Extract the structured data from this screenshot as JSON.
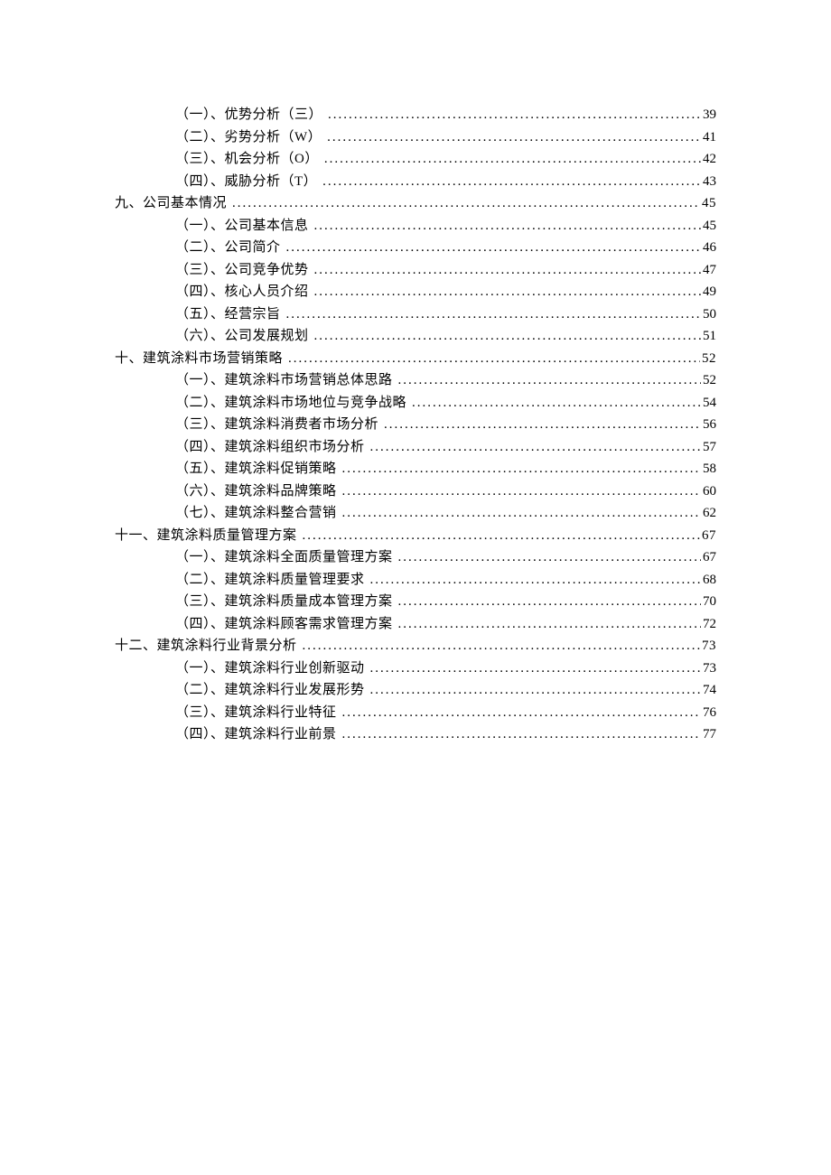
{
  "toc": [
    {
      "level": 2,
      "label": "（一）、优势分析（三）",
      "page": "39"
    },
    {
      "level": 2,
      "label": "（二）、劣势分析（W）",
      "page": "41"
    },
    {
      "level": 2,
      "label": "（三）、机会分析（O）",
      "page": "42"
    },
    {
      "level": 2,
      "label": "（四）、威胁分析（T）",
      "page": "43"
    },
    {
      "level": 1,
      "label": "九、公司基本情况",
      "page": "45"
    },
    {
      "level": 2,
      "label": "（一）、公司基本信息",
      "page": "45"
    },
    {
      "level": 2,
      "label": "（二）、公司简介",
      "page": "46"
    },
    {
      "level": 2,
      "label": "（三）、公司竞争优势",
      "page": "47"
    },
    {
      "level": 2,
      "label": "（四）、核心人员介绍",
      "page": "49"
    },
    {
      "level": 2,
      "label": "（五）、经营宗旨",
      "page": "50"
    },
    {
      "level": 2,
      "label": "（六）、公司发展规划",
      "page": "51"
    },
    {
      "level": 1,
      "label": "十、建筑涂料市场营销策略",
      "page": "52"
    },
    {
      "level": 2,
      "label": "（一）、建筑涂料市场营销总体思路",
      "page": "52"
    },
    {
      "level": 2,
      "label": "（二）、建筑涂料市场地位与竞争战略",
      "page": "54"
    },
    {
      "level": 2,
      "label": "（三）、建筑涂料消费者市场分析",
      "page": "56"
    },
    {
      "level": 2,
      "label": "（四）、建筑涂料组织市场分析",
      "page": "57"
    },
    {
      "level": 2,
      "label": "（五）、建筑涂料促销策略",
      "page": "58"
    },
    {
      "level": 2,
      "label": "（六）、建筑涂料品牌策略",
      "page": "60"
    },
    {
      "level": 2,
      "label": "（七）、建筑涂料整合营销",
      "page": "62"
    },
    {
      "level": 1,
      "label": "十一、建筑涂料质量管理方案",
      "page": "67"
    },
    {
      "level": 2,
      "label": "（一）、建筑涂料全面质量管理方案",
      "page": "67"
    },
    {
      "level": 2,
      "label": "（二）、建筑涂料质量管理要求",
      "page": "68"
    },
    {
      "level": 2,
      "label": "（三）、建筑涂料质量成本管理方案",
      "page": "70"
    },
    {
      "level": 2,
      "label": "（四）、建筑涂料顾客需求管理方案",
      "page": "72"
    },
    {
      "level": 1,
      "label": "十二、建筑涂料行业背景分析",
      "page": "73"
    },
    {
      "level": 2,
      "label": "（一）、建筑涂料行业创新驱动",
      "page": "73"
    },
    {
      "level": 2,
      "label": "（二）、建筑涂料行业发展形势",
      "page": "74"
    },
    {
      "level": 2,
      "label": "（三）、建筑涂料行业特征",
      "page": "76"
    },
    {
      "level": 2,
      "label": "（四）、建筑涂料行业前景",
      "page": "77"
    }
  ]
}
